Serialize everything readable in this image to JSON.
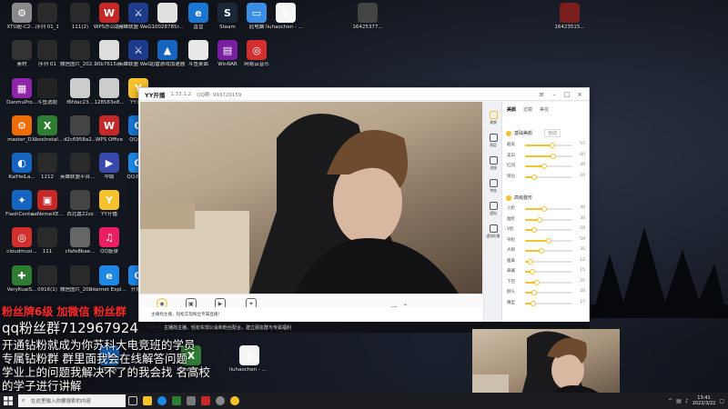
{
  "desktop": {
    "icons": [
      {
        "label": "XTU超-C2-...",
        "color": "#8a8a8a",
        "glyph": "⚙"
      },
      {
        "label": "序列 01_1",
        "color": "#2a2a2a",
        "glyph": ""
      },
      {
        "label": "111(2)",
        "color": "#2a2a2a",
        "glyph": ""
      },
      {
        "label": "WPS办公助手",
        "color": "#c62828",
        "glyph": "W"
      },
      {
        "label": "英雄联盟 WeGame版",
        "color": "#1e3a8a",
        "glyph": "⚔"
      },
      {
        "label": "10028785r...",
        "color": "#e0e0e0",
        "glyph": ""
      },
      {
        "label": "直营",
        "color": "#1976d2",
        "glyph": "e"
      },
      {
        "label": "Steam",
        "color": "#1b2838",
        "glyph": "S"
      },
      {
        "label": "此电脑",
        "color": "#3a8ee6",
        "glyph": "▭"
      },
      {
        "label": "liuhaochen - 快捷方式 (2)",
        "color": "#f5f5f5",
        "glyph": "≡"
      },
      {
        "label": "16425377...",
        "color": "#444",
        "glyph": ""
      },
      {
        "label": "16423515...",
        "color": "#7a1e1e",
        "glyph": ""
      },
      {
        "label": "素材",
        "color": "#333",
        "glyph": ""
      },
      {
        "label": "序列 01",
        "color": "#2a2a2a",
        "glyph": ""
      },
      {
        "label": "微信图片_2021102...",
        "color": "#2a2a2a",
        "glyph": ""
      },
      {
        "label": "90b7615d...",
        "color": "#ddd",
        "glyph": ""
      },
      {
        "label": "英雄联盟 WeGame版",
        "color": "#1e3a8a",
        "glyph": "⚔"
      },
      {
        "label": "迅雷游戏加速器",
        "color": "#1565c0",
        "glyph": "▲"
      },
      {
        "label": "斗鱼桌面",
        "color": "#e8e8e8",
        "glyph": ""
      },
      {
        "label": "WinRAR",
        "color": "#7b1fa2",
        "glyph": "▤"
      },
      {
        "label": "网易云音乐",
        "color": "#d32f2f",
        "glyph": "◎"
      },
      {
        "label": "DanmuPro...",
        "color": "#8e24aa",
        "glyph": "▦"
      },
      {
        "label": "斗鱼选题",
        "color": "#222",
        "glyph": ""
      },
      {
        "label": "f6fdac23...",
        "color": "#ccc",
        "glyph": ""
      },
      {
        "label": "128583e8...",
        "color": "#ccc",
        "glyph": ""
      },
      {
        "label": "YY语音",
        "color": "#f6c12b",
        "glyph": "Y"
      },
      {
        "label": "master_D...",
        "color": "#ef6c00",
        "glyph": "⚙"
      },
      {
        "label": "XboxInstal...",
        "color": "#2e7d32",
        "glyph": "X"
      },
      {
        "label": "d2c6958a2...",
        "color": "#444",
        "glyph": ""
      },
      {
        "label": "WPS Office",
        "color": "#c62828",
        "glyph": "W"
      },
      {
        "label": "QQ游戏",
        "color": "#1976d2",
        "glyph": "Q"
      },
      {
        "label": "KaiHeiLa...",
        "color": "#1565c0",
        "glyph": "◐"
      },
      {
        "label": "1212",
        "color": "#2a2a2a",
        "glyph": ""
      },
      {
        "label": "英雄联盟平台个性化背景...",
        "color": "#2a2a2a",
        "glyph": ""
      },
      {
        "label": "中版",
        "color": "#3949ab",
        "glyph": "▶"
      },
      {
        "label": "QQ浏览器",
        "color": "#1e88e5",
        "glyph": "Q"
      },
      {
        "label": "FlashCente...",
        "color": "#1565c0",
        "glyph": "✦"
      },
      {
        "label": "aeNemeXE...",
        "color": "#c62828",
        "glyph": "▣"
      },
      {
        "label": "西北嘉22zz",
        "color": "#444",
        "glyph": ""
      },
      {
        "label": "YY开播",
        "color": "#f6c12b",
        "glyph": "Y"
      },
      {
        "label": "cloudmusi...",
        "color": "#d32f2f",
        "glyph": "◎"
      },
      {
        "label": "111",
        "color": "#2a2a2a",
        "glyph": ""
      },
      {
        "label": "cfafe8bae...",
        "color": "#666",
        "glyph": ""
      },
      {
        "label": "QQ旋律",
        "color": "#e91e63",
        "glyph": "♫"
      },
      {
        "label": "VeryKuaiS...",
        "color": "#2e7d32",
        "glyph": "✚"
      },
      {
        "label": "0916(1)",
        "color": "#2a2a2a",
        "glyph": ""
      },
      {
        "label": "微信图片_2021111...",
        "color": "#2a2a2a",
        "glyph": ""
      },
      {
        "label": "Internet Explorer",
        "color": "#1e88e5",
        "glyph": "e"
      },
      {
        "label": "开播助",
        "color": "#1e88e5",
        "glyph": "Q"
      },
      {
        "label": "Plants Zombies",
        "color": "#aaa",
        "glyph": ""
      },
      {
        "label": "加速器",
        "color": "#1565c0",
        "glyph": "✈"
      },
      {
        "label": "Experience",
        "color": "#2e7d32",
        "glyph": "X"
      },
      {
        "label": "liuhaochen - 快捷方式",
        "color": "#f5f5f5",
        "glyph": "≡"
      }
    ]
  },
  "yy": {
    "app_name": "YY开播",
    "version": "1.33.1.2",
    "qq_id": "QQ群: 993720159",
    "colors": {
      "accent": "#f6c12b"
    },
    "tools": [
      {
        "label": "摄像头",
        "icon": "camera-icon"
      },
      {
        "label": "捕捉",
        "icon": "capture-icon"
      },
      {
        "label": "多媒体",
        "icon": "media-icon"
      },
      {
        "label": "一起看",
        "icon": "watch-together-icon"
      }
    ],
    "side_items": [
      {
        "label": "美颜",
        "icon": "beauty-icon"
      },
      {
        "label": "图层",
        "icon": "layer-icon"
      },
      {
        "label": "滤镜",
        "icon": "filter-icon"
      },
      {
        "label": "特效",
        "icon": "effect-icon"
      },
      {
        "label": "虚拟",
        "icon": "avatar-icon"
      },
      {
        "label": "虚拟形象",
        "icon": "virtual-icon"
      }
    ],
    "panel": {
      "tabs": [
        "美颜",
        "滤镜",
        "美妆"
      ],
      "section1": "基础美颜",
      "section1_mode": "自动",
      "section2": "高级整形",
      "sliders1": [
        {
          "label": "磨皮",
          "value": 57
        },
        {
          "label": "美白",
          "value": 60
        },
        {
          "label": "红润",
          "value": 40
        },
        {
          "label": "锐化",
          "value": 20
        }
      ],
      "sliders2": [
        {
          "label": "小脸",
          "value": 40
        },
        {
          "label": "瘦脸",
          "value": 30
        },
        {
          "label": "V脸",
          "value": 20
        },
        {
          "label": "窄脸",
          "value": 50
        },
        {
          "label": "大眼",
          "value": 35
        },
        {
          "label": "瘦鼻",
          "value": 12
        },
        {
          "label": "鼻翼",
          "value": 15
        },
        {
          "label": "下巴",
          "value": 25
        },
        {
          "label": "额头",
          "value": 20
        },
        {
          "label": "嘴型",
          "value": 17
        }
      ]
    },
    "status": "主播找主播，轻松实现粉丝专属直播！"
  },
  "notification": "主播找主播，轻松实现公会和粉丝配合，建立朋友群与专属福利",
  "overlay": {
    "red": "粉丝牌6级 加微信 粉丝群",
    "qq": "qq粉丝群712967924",
    "lines": [
      "开通钻粉就成为你苏科大电竞班的学员",
      "专属钻粉群 群里面我会在线解答问题",
      "学业上的问题我解决不了的我会找 名高校",
      "的学子进行讲解"
    ]
  },
  "taskbar": {
    "search_placeholder": "在这里输入你要搜索的内容",
    "time": "13:41",
    "date": "2022/3/22"
  }
}
